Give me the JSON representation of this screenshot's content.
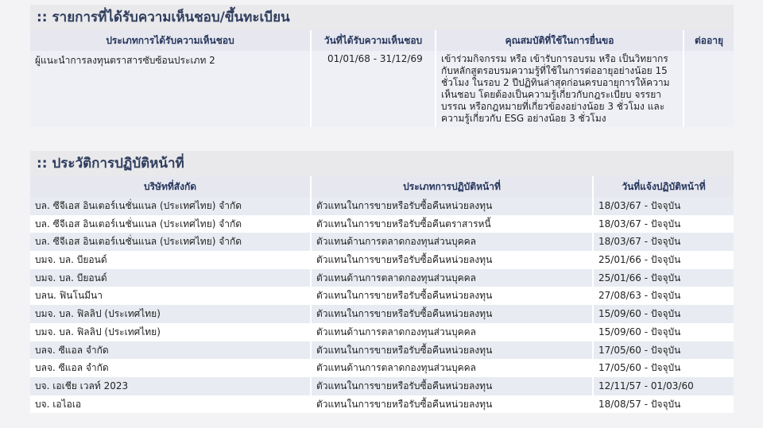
{
  "section1": {
    "title": ":: รายการที่ได้รับความเห็นชอบ/ขึ้นทะเบียน",
    "headers": [
      "ประเภทการได้รับความเห็นชอบ",
      "วันที่ได้รับความเห็นชอบ",
      "คุณสมบัติที่ใช้ในการยื่นขอ",
      "ต่ออายุ"
    ],
    "rows": [
      {
        "type": "ผู้แนะนำการลงทุนตราสารซับซ้อนประเภท 2",
        "date": "01/01/68 - 31/12/69",
        "qualification": "เข้าร่วมกิจกรรม หรือ เข้ารับการอบรม หรือ เป็นวิทยากร กับหลักสูตรอบรมความรู้ที่ใช้ในการต่ออายุอย่างน้อย 15 ชั่วโมง ในรอบ 2 ปีปฏิทินล่าสุดก่อนครบอายุการให้ความเห็นชอบ โดยต้องเป็นความรู้เกี่ยวกับกฎระเบียบ จรรยาบรรณ หรือกฎหมายที่เกี่ยวข้องอย่างน้อย 3 ชั่วโมง และความรู้เกี่ยวกับ ESG อย่างน้อย 3 ชั่วโมง",
        "renew": ""
      }
    ]
  },
  "section2": {
    "title": ":: ประวัติการปฏิบัติหน้าที่",
    "headers": [
      "บริษัทที่สังกัด",
      "ประเภทการปฏิบัติหน้าที่",
      "วันที่แจ้งปฏิบัติหน้าที่"
    ],
    "rows": [
      {
        "company": "บล. ซีจีเอส อินเตอร์เนชั่นแนล (ประเทศไทย) จำกัด",
        "duty": "ตัวแทนในการขายหรือรับซื้อคืนหน่วยลงทุน",
        "date": "18/03/67 - ปัจจุบัน"
      },
      {
        "company": "บล. ซีจีเอส อินเตอร์เนชั่นแนล (ประเทศไทย) จำกัด",
        "duty": "ตัวแทนในการขายหรือรับซื้อคืนตราสารหนี้",
        "date": "18/03/67 - ปัจจุบัน"
      },
      {
        "company": "บล. ซีจีเอส อินเตอร์เนชั่นแนล (ประเทศไทย) จำกัด",
        "duty": "ตัวแทนด้านการตลาดกองทุนส่วนบุคคล",
        "date": "18/03/67 - ปัจจุบัน"
      },
      {
        "company": "บมจ. บล. บียอนด์",
        "duty": "ตัวแทนในการขายหรือรับซื้อคืนหน่วยลงทุน",
        "date": "25/01/66 - ปัจจุบัน"
      },
      {
        "company": "บมจ. บล. บียอนด์",
        "duty": "ตัวแทนด้านการตลาดกองทุนส่วนบุคคล",
        "date": "25/01/66 - ปัจจุบัน"
      },
      {
        "company": "บลน. ฟินโนมีนา",
        "duty": "ตัวแทนในการขายหรือรับซื้อคืนหน่วยลงทุน",
        "date": "27/08/63 - ปัจจุบัน"
      },
      {
        "company": "บมจ. บล. ฟิลลิป (ประเทศไทย)",
        "duty": "ตัวแทนในการขายหรือรับซื้อคืนหน่วยลงทุน",
        "date": "15/09/60 - ปัจจุบัน"
      },
      {
        "company": "บมจ. บล. ฟิลลิป (ประเทศไทย)",
        "duty": "ตัวแทนด้านการตลาดกองทุนส่วนบุคคล",
        "date": "15/09/60 - ปัจจุบัน"
      },
      {
        "company": "บลจ. ซีแอล จำกัด",
        "duty": "ตัวแทนในการขายหรือรับซื้อคืนหน่วยลงทุน",
        "date": "17/05/60 - ปัจจุบัน"
      },
      {
        "company": "บลจ. ซีแอล จำกัด",
        "duty": "ตัวแทนด้านการตลาดกองทุนส่วนบุคคล",
        "date": "17/05/60 - ปัจจุบัน"
      },
      {
        "company": "บจ. เอเชีย เวลท์ 2023",
        "duty": "ตัวแทนในการขายหรือรับซื้อคืนหน่วยลงทุน",
        "date": "12/11/57 - 01/03/60"
      },
      {
        "company": "บจ. เอไอเอ",
        "duty": "ตัวแทนในการขายหรือรับซื้อคืนหน่วยลงทุน",
        "date": "18/08/57 - ปัจจุบัน"
      }
    ]
  }
}
